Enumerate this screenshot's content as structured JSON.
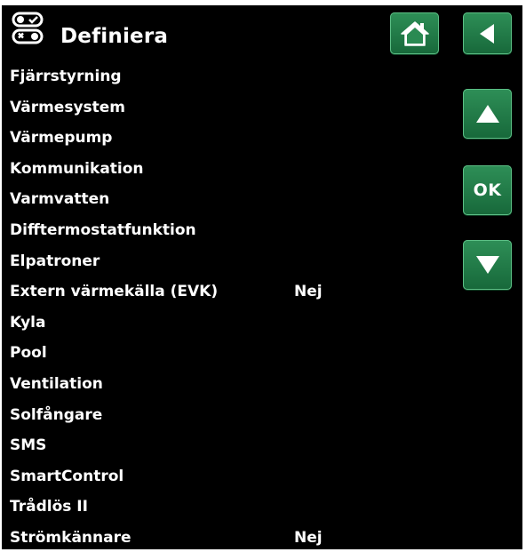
{
  "header": {
    "title": "Definiera",
    "icon": "toggle-switches-icon"
  },
  "nav": {
    "home_icon": "home-icon",
    "back_icon": "back-arrow-icon",
    "up_icon": "up-arrow-icon",
    "ok_label": "OK",
    "down_icon": "down-arrow-icon"
  },
  "menu": {
    "items": [
      {
        "label": "Fjärrstyrning",
        "value": ""
      },
      {
        "label": "Värmesystem",
        "value": ""
      },
      {
        "label": "Värmepump",
        "value": ""
      },
      {
        "label": "Kommunikation",
        "value": ""
      },
      {
        "label": "Varmvatten",
        "value": ""
      },
      {
        "label": "Difftermostatfunktion",
        "value": ""
      },
      {
        "label": "Elpatroner",
        "value": ""
      },
      {
        "label": "Extern värmekälla (EVK)",
        "value": "Nej"
      },
      {
        "label": "Kyla",
        "value": ""
      },
      {
        "label": "Pool",
        "value": ""
      },
      {
        "label": "Ventilation",
        "value": ""
      },
      {
        "label": "Solfångare",
        "value": ""
      },
      {
        "label": "SMS",
        "value": ""
      },
      {
        "label": "SmartControl",
        "value": ""
      },
      {
        "label": "Trådlös II",
        "value": ""
      },
      {
        "label": "Strömkännare",
        "value": "Nej"
      }
    ]
  },
  "colors": {
    "background": "#000000",
    "text": "#ffffff",
    "button": "#1f7a45"
  }
}
